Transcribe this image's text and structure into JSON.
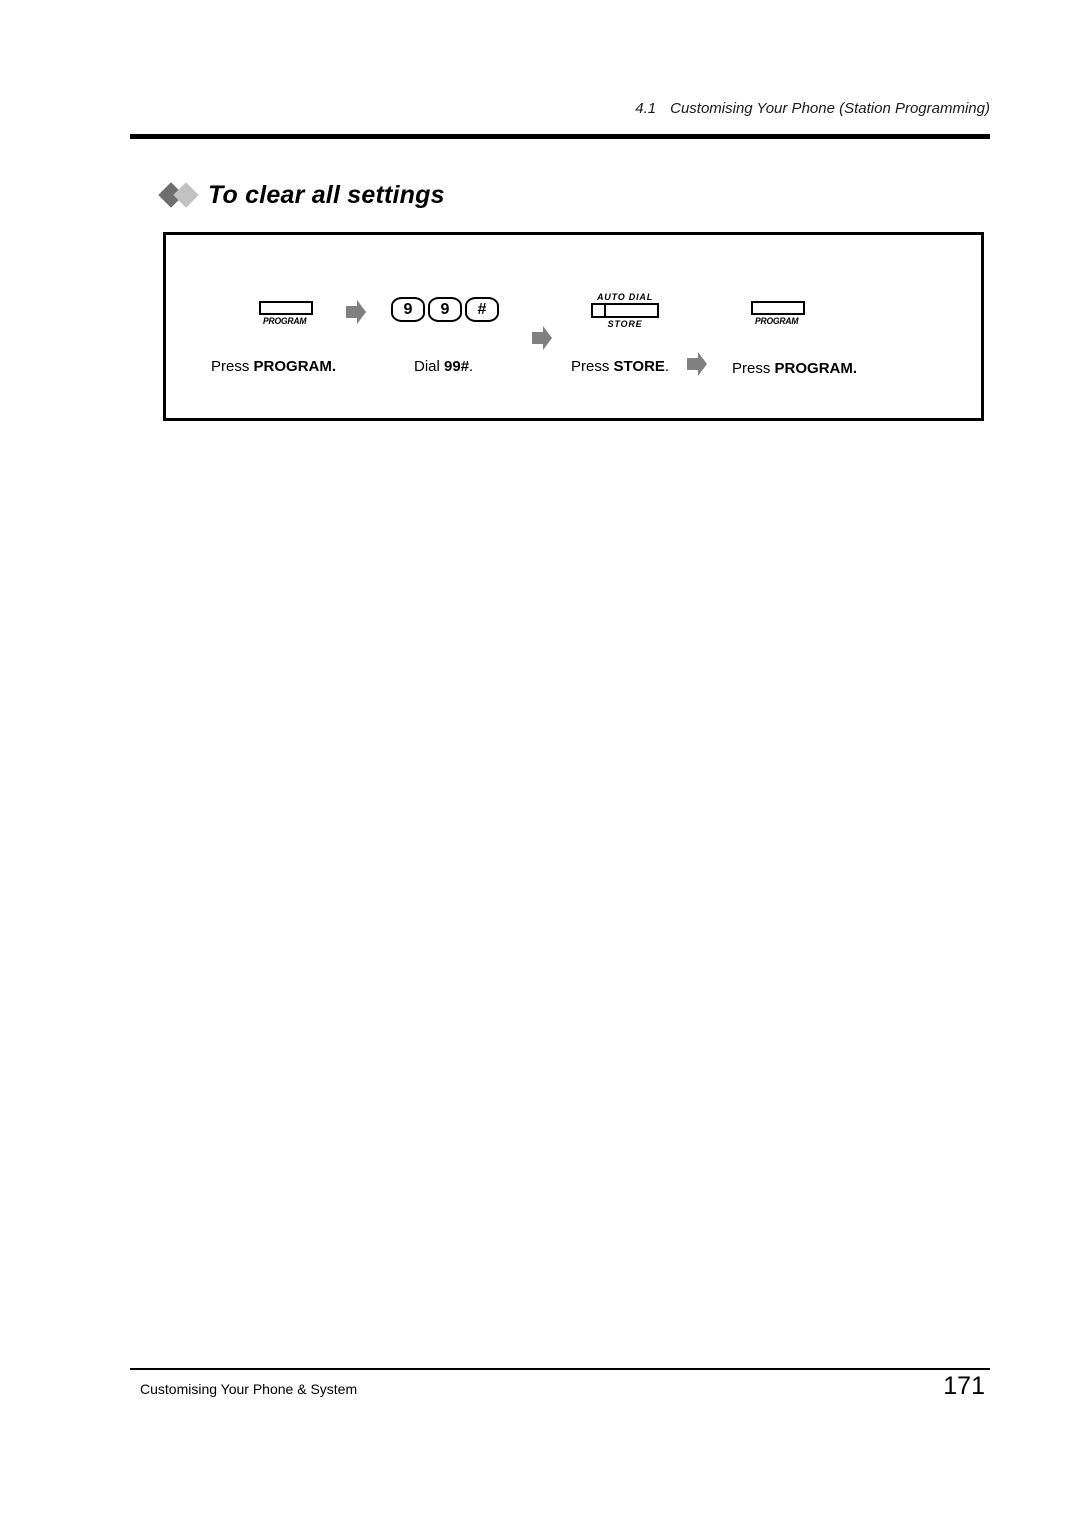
{
  "header": {
    "section_number": "4.1",
    "section_title": "Customising Your Phone (Station Programming)"
  },
  "title": {
    "text": "To clear all settings",
    "bullet_colors": [
      "#6e6e6e",
      "#c2c2c2"
    ]
  },
  "procedure": {
    "steps": [
      {
        "key_type": "program-button",
        "key_label": "PROGRAM",
        "caption_prefix": "Press ",
        "caption_bold": "PROGRAM.",
        "caption_suffix": ""
      },
      {
        "key_type": "dial-keys",
        "keys": [
          "9",
          "9",
          "#"
        ],
        "caption_prefix": "Dial ",
        "caption_bold": "99#",
        "caption_suffix": "."
      },
      {
        "key_type": "store-button",
        "key_label_top": "AUTO DIAL",
        "key_label_bottom": "STORE",
        "caption_prefix": "Press ",
        "caption_bold": "STORE",
        "caption_suffix": "."
      },
      {
        "key_type": "program-button",
        "key_label": "PROGRAM",
        "caption_prefix": "Press ",
        "caption_bold": "PROGRAM.",
        "caption_suffix": ""
      }
    ],
    "arrow_color": "#808080",
    "arrow_count": 3
  },
  "footer": {
    "left_text": "Customising Your Phone & System",
    "page_number": "171"
  }
}
